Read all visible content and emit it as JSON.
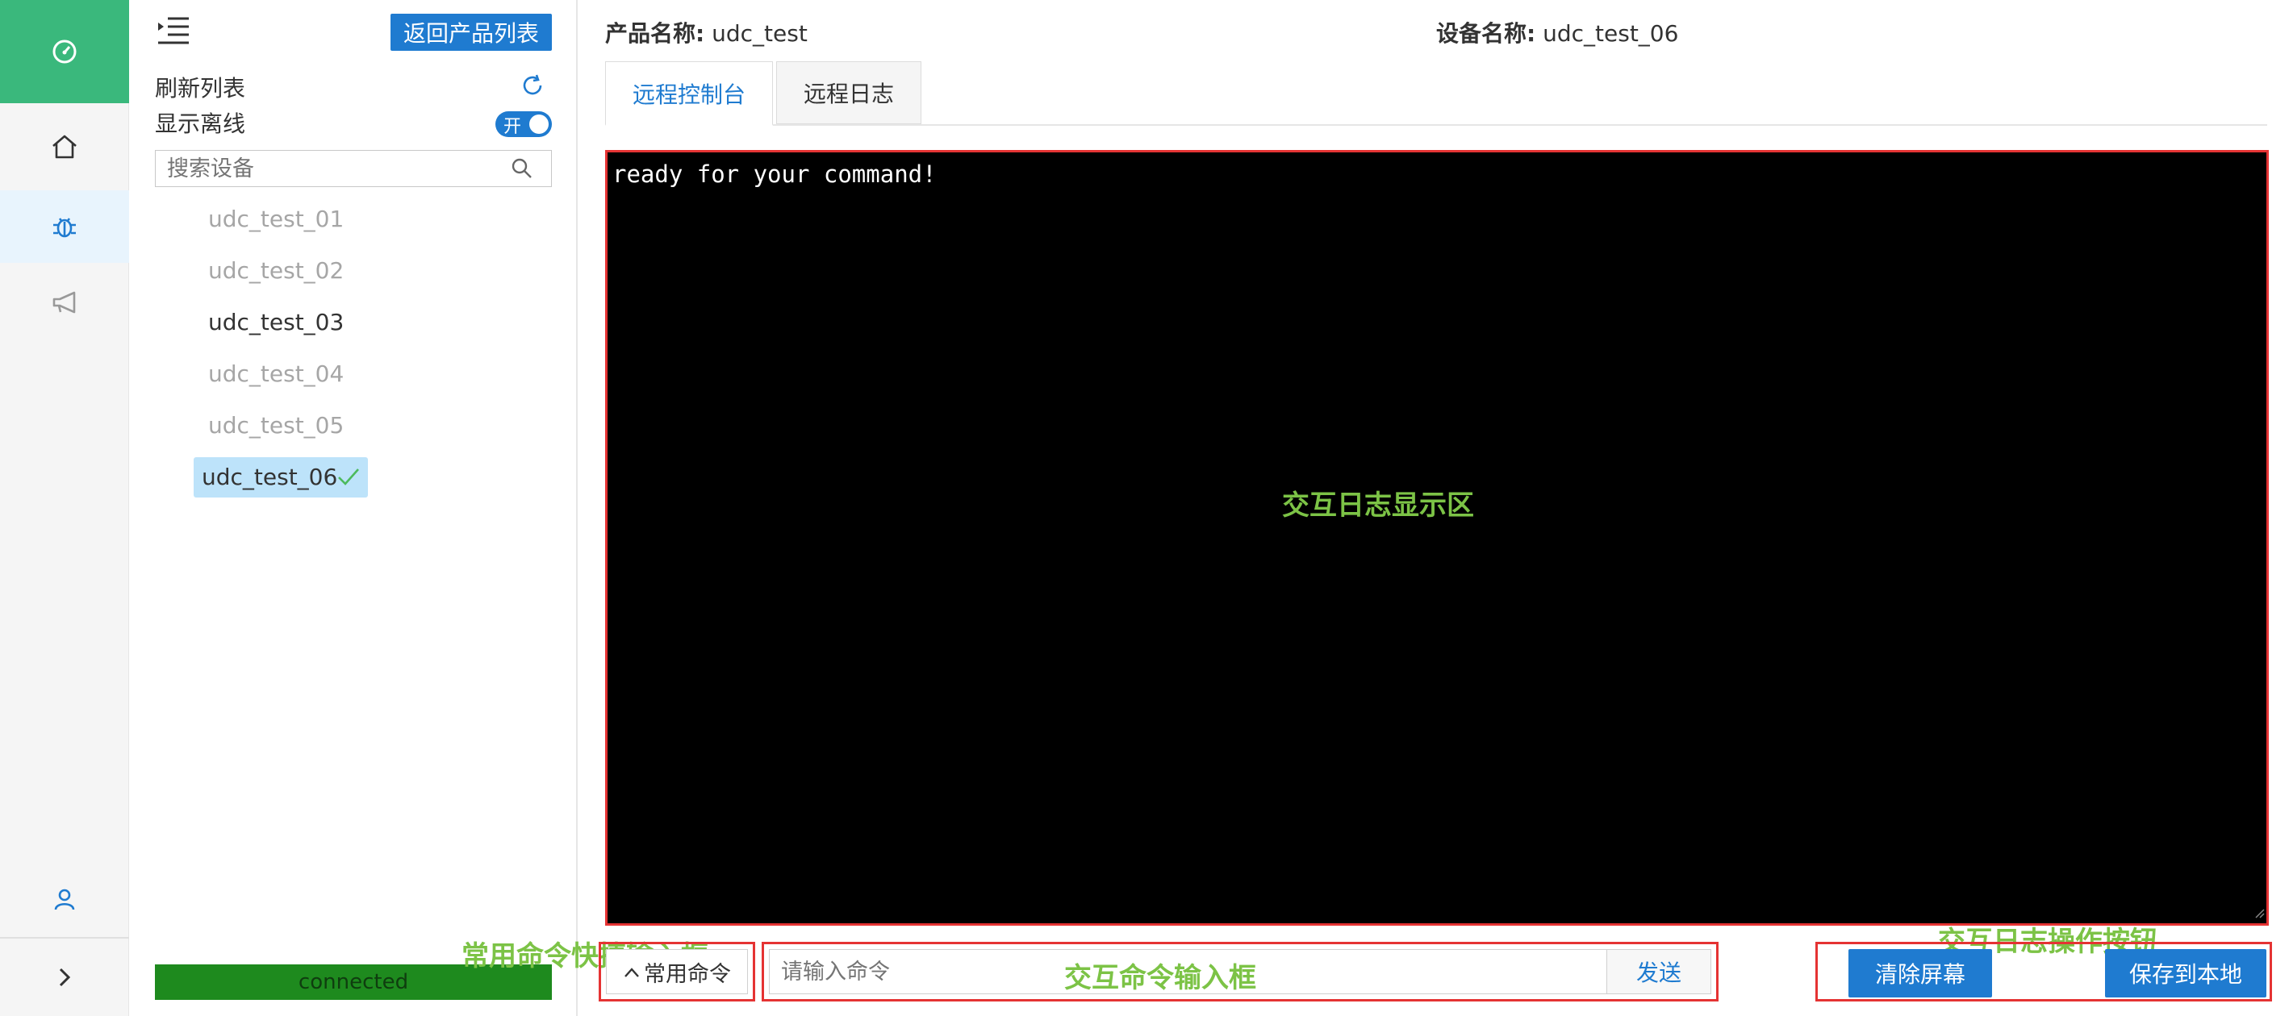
{
  "sidebar": {
    "items": [
      {
        "name": "dashboard-icon"
      },
      {
        "name": "home-icon"
      },
      {
        "name": "bug-icon"
      },
      {
        "name": "megaphone-icon"
      },
      {
        "name": "user-icon"
      },
      {
        "name": "chevron-right-icon"
      }
    ],
    "accent": "#3ab87c"
  },
  "device_panel": {
    "back_button": "返回产品列表",
    "refresh_label": "刷新列表",
    "show_offline_label": "显示离线",
    "toggle_text": "开",
    "search_placeholder": "搜索设备",
    "devices": [
      {
        "name": "udc_test_01",
        "status": "offline"
      },
      {
        "name": "udc_test_02",
        "status": "offline"
      },
      {
        "name": "udc_test_03",
        "status": "online"
      },
      {
        "name": "udc_test_04",
        "status": "offline"
      },
      {
        "name": "udc_test_05",
        "status": "offline"
      },
      {
        "name": "udc_test_06",
        "status": "selected"
      }
    ],
    "connection_status": "connected"
  },
  "header": {
    "product_label": "产品名称:",
    "product_value": "udc_test",
    "device_label": "设备名称:",
    "device_value": "udc_test_06"
  },
  "tabs": [
    {
      "label": "远程控制台",
      "active": true
    },
    {
      "label": "远程日志",
      "active": false
    }
  ],
  "console": {
    "output": "ready for your command!",
    "area_annotation": "交互日志显示区"
  },
  "command_bar": {
    "quick_cmd_label": "常用命令",
    "input_placeholder": "请输入命令",
    "send_label": "发送",
    "clear_label": "清除屏幕",
    "save_label": "保存到本地"
  },
  "annotations": {
    "quick_cmd": "常用命令快捷输入框",
    "input": "交互命令输入框",
    "actions": "交互日志操作按钮"
  }
}
